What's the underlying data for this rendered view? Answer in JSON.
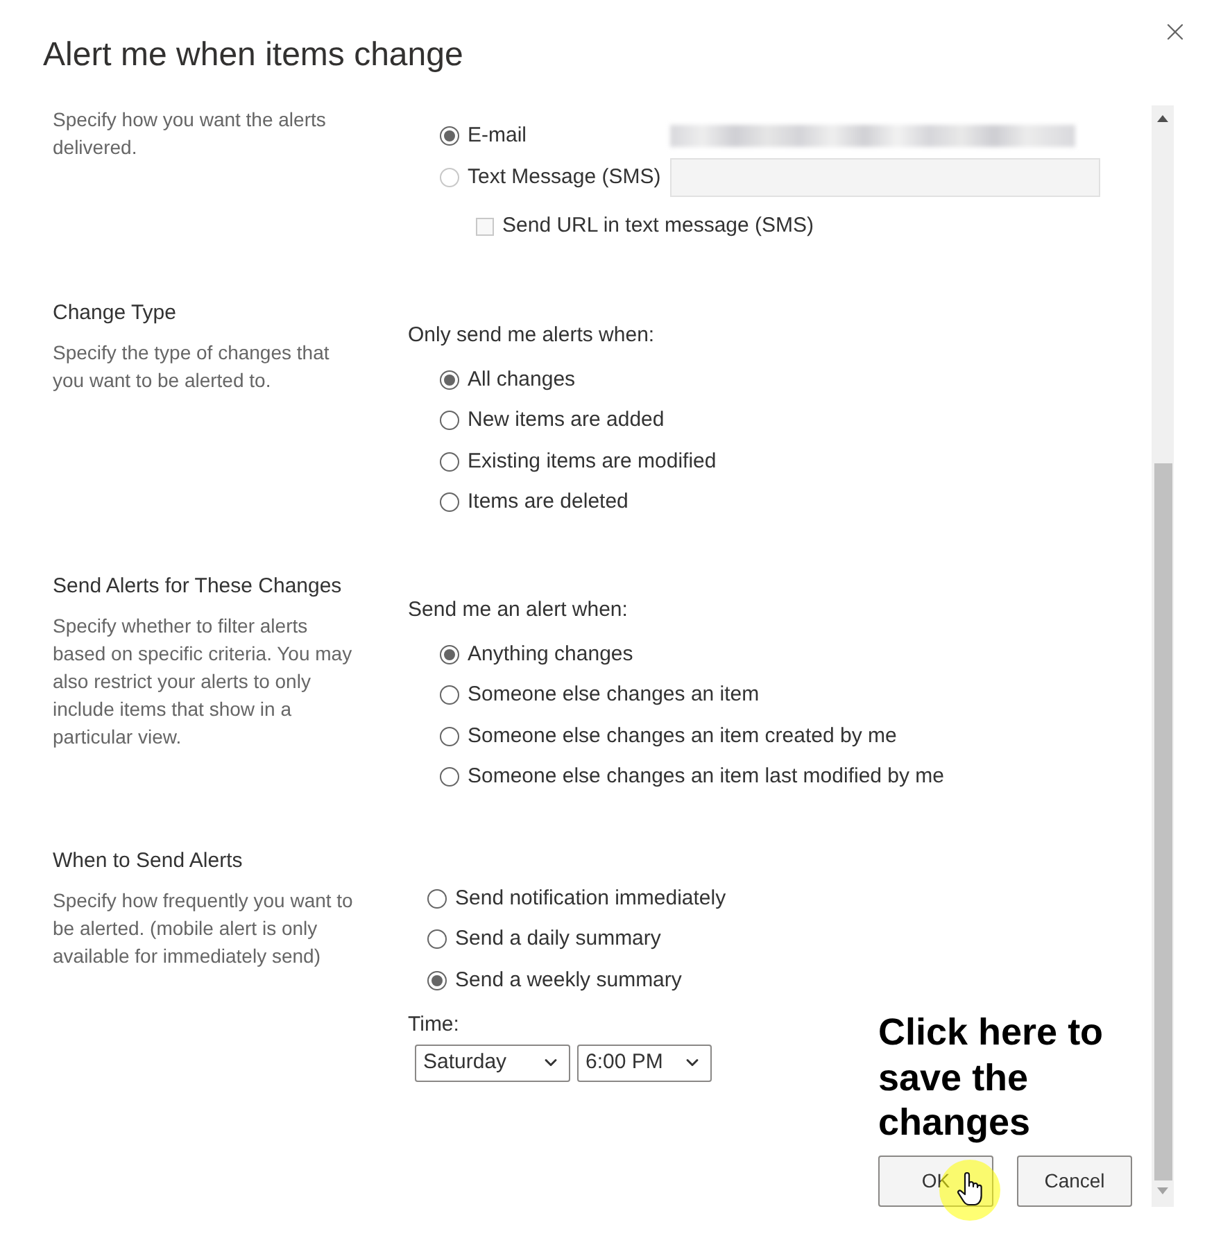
{
  "dialog": {
    "title": "Alert me when items change"
  },
  "sections": [
    {
      "kind": "delivery",
      "description": "Specify how you want the alerts delivered.",
      "options": [
        {
          "kind": "email",
          "label": "E-mail",
          "selected": true,
          "disabled": false
        },
        {
          "kind": "sms",
          "label": "Text Message (SMS)",
          "selected": false,
          "disabled": true
        }
      ],
      "checkbox": {
        "label": "Send URL in text message (SMS)",
        "checked": false,
        "disabled": true
      }
    },
    {
      "kind": "change_type",
      "heading": "Change Type",
      "description": "Specify the type of changes that you want to be alerted to.",
      "prompt": "Only send me alerts when:",
      "options": [
        {
          "label": "All changes",
          "selected": true
        },
        {
          "label": "New items are added",
          "selected": false
        },
        {
          "label": "Existing items are modified",
          "selected": false
        },
        {
          "label": "Items are deleted",
          "selected": false
        }
      ]
    },
    {
      "kind": "filter",
      "heading": "Send Alerts for These Changes",
      "description": "Specify whether to filter alerts based on specific criteria. You may also restrict your alerts to only include items that show in a particular view.",
      "prompt": "Send me an alert when:",
      "options": [
        {
          "label": "Anything changes",
          "selected": true
        },
        {
          "label": "Someone else changes an item",
          "selected": false
        },
        {
          "label": "Someone else changes an item created by me",
          "selected": false
        },
        {
          "label": "Someone else changes an item last modified by me",
          "selected": false
        }
      ]
    },
    {
      "kind": "schedule",
      "heading": "When to Send Alerts",
      "description": "Specify how frequently you want to be alerted. (mobile alert is only available for immediately send)",
      "options": [
        {
          "label": "Send notification immediately",
          "selected": false
        },
        {
          "label": "Send a daily summary",
          "selected": false
        },
        {
          "label": "Send a weekly summary",
          "selected": true
        }
      ],
      "time": {
        "label": "Time:",
        "day": "Saturday",
        "hour": "6:00 PM"
      }
    }
  ],
  "buttons": [
    {
      "label": "OK"
    },
    {
      "label": "Cancel"
    }
  ],
  "annotation": {
    "text": "Click here to save the changes"
  }
}
